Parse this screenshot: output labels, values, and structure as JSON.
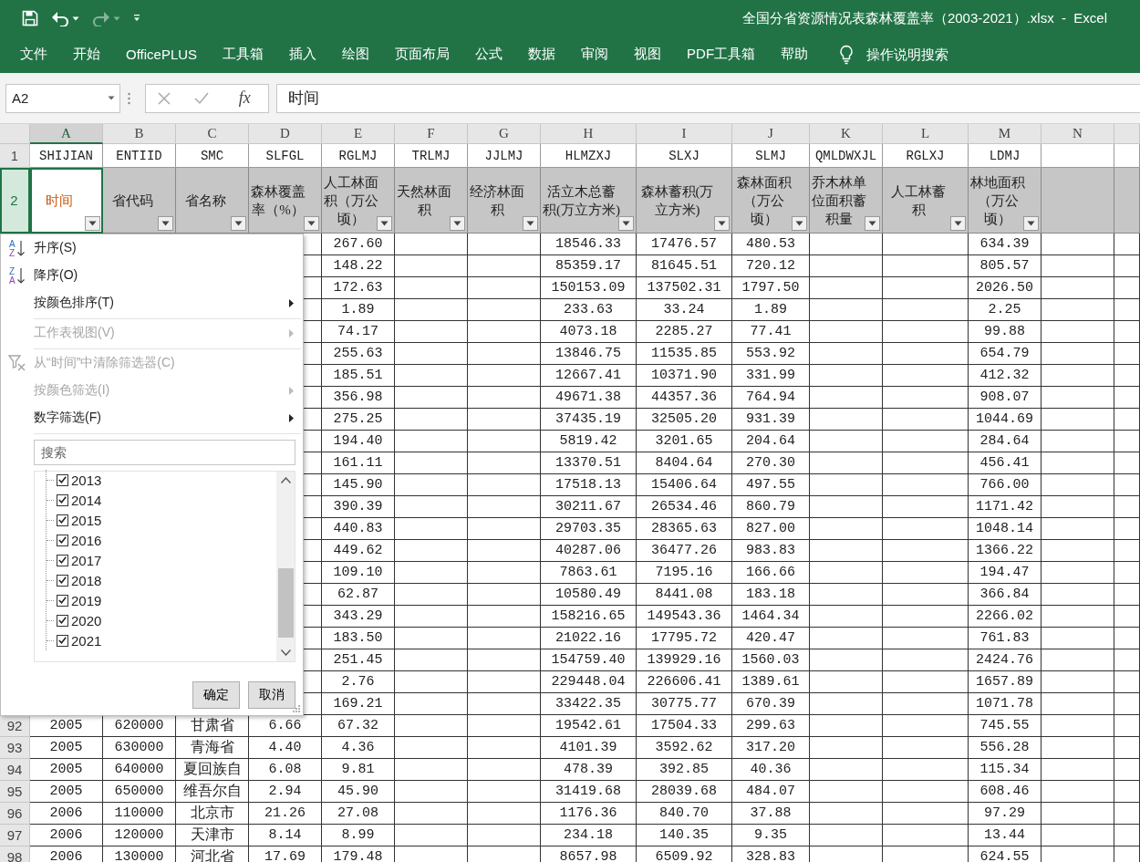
{
  "title_bar": {
    "quick_access": [
      {
        "kind": "save",
        "disabled": false
      },
      {
        "kind": "undo",
        "disabled": false
      },
      {
        "kind": "redo",
        "disabled": true
      },
      {
        "kind": "customize",
        "disabled": false
      }
    ],
    "title": "全国分省资源情况表森林覆盖率（2003-2021）.xlsx  -  Excel"
  },
  "ribbon": {
    "tabs": [
      {
        "label": "文件",
        "selected": false
      },
      {
        "label": "开始",
        "selected": false
      },
      {
        "label": "OfficePLUS",
        "selected": false
      },
      {
        "label": "工具箱",
        "selected": false
      },
      {
        "label": "插入",
        "selected": false
      },
      {
        "label": "绘图",
        "selected": false
      },
      {
        "label": "页面布局",
        "selected": false
      },
      {
        "label": "公式",
        "selected": false
      },
      {
        "label": "数据",
        "selected": false
      },
      {
        "label": "审阅",
        "selected": false
      },
      {
        "label": "视图",
        "selected": false
      },
      {
        "label": "PDF工具箱",
        "selected": false
      },
      {
        "label": "帮助",
        "selected": false
      }
    ],
    "tell_me": "操作说明搜索"
  },
  "formula_bar": {
    "name_box": "A2",
    "function_label": "fx",
    "value": "时间"
  },
  "sheet": {
    "columns": [
      {
        "letter": "A",
        "field": "SHIJIAN",
        "header": "时间",
        "selected": true
      },
      {
        "letter": "B",
        "field": "ENTIID",
        "header": "省代码",
        "selected": false
      },
      {
        "letter": "C",
        "field": "SMC",
        "header": "省名称",
        "selected": false
      },
      {
        "letter": "D",
        "field": "SLFGL",
        "header": "森林覆盖率（%）",
        "selected": false
      },
      {
        "letter": "E",
        "field": "RGLMJ",
        "header": "人工林面积（万公顷）",
        "selected": false
      },
      {
        "letter": "F",
        "field": "TRLMJ",
        "header": "天然林面积",
        "selected": false
      },
      {
        "letter": "G",
        "field": "JJLMJ",
        "header": "经济林面积",
        "selected": false
      },
      {
        "letter": "H",
        "field": "HLMZXJ",
        "header": "活立木总蓄积(万立方米)",
        "selected": false
      },
      {
        "letter": "I",
        "field": "SLXJ",
        "header": "森林蓄积(万立方米)",
        "selected": false
      },
      {
        "letter": "J",
        "field": "SLMJ",
        "header": "森林面积（万公顷）",
        "selected": false
      },
      {
        "letter": "K",
        "field": "QMLDWXJL",
        "header": "乔木林单位面积蓄积量",
        "selected": false
      },
      {
        "letter": "L",
        "field": "RGLXJ",
        "header": "人工林蓄积",
        "selected": false
      },
      {
        "letter": "M",
        "field": "LDMJ",
        "header": "林地面积（万公顷）",
        "selected": false
      },
      {
        "letter": "N",
        "selected": false
      }
    ],
    "field_row": {
      "number": "1"
    },
    "header_row": {
      "number": "2",
      "selected": true
    },
    "rows": [
      {
        "cells": {
          "E": "267.60",
          "H": "18546.33",
          "I": "17476.57",
          "J": "480.53",
          "M": "634.39"
        }
      },
      {
        "cells": {
          "E": "148.22",
          "H": "85359.17",
          "I": "81645.51",
          "J": "720.12",
          "M": "805.57"
        }
      },
      {
        "cells": {
          "E": "172.63",
          "H": "150153.09",
          "I": "137502.31",
          "J": "1797.50",
          "M": "2026.50"
        }
      },
      {
        "cells": {
          "E": "1.89",
          "H": "233.63",
          "I": "33.24",
          "J": "1.89",
          "M": "2.25"
        }
      },
      {
        "cells": {
          "E": "74.17",
          "H": "4073.18",
          "I": "2285.27",
          "J": "77.41",
          "M": "99.88"
        }
      },
      {
        "cells": {
          "E": "255.63",
          "H": "13846.75",
          "I": "11535.85",
          "J": "553.92",
          "M": "654.79"
        }
      },
      {
        "cells": {
          "E": "185.51",
          "H": "12667.41",
          "I": "10371.90",
          "J": "331.99",
          "M": "412.32"
        }
      },
      {
        "cells": {
          "E": "356.98",
          "H": "49671.38",
          "I": "44357.36",
          "J": "764.94",
          "M": "908.07"
        }
      },
      {
        "cells": {
          "E": "275.25",
          "H": "37435.19",
          "I": "32505.20",
          "J": "931.39",
          "M": "1044.69"
        }
      },
      {
        "cells": {
          "E": "194.40",
          "H": "5819.42",
          "I": "3201.65",
          "J": "204.64",
          "M": "284.64"
        }
      },
      {
        "cells": {
          "E": "161.11",
          "H": "13370.51",
          "I": "8404.64",
          "J": "270.30",
          "M": "456.41"
        }
      },
      {
        "cells": {
          "E": "145.90",
          "H": "17518.13",
          "I": "15406.64",
          "J": "497.55",
          "M": "766.00"
        }
      },
      {
        "cells": {
          "E": "390.39",
          "H": "30211.67",
          "I": "26534.46",
          "J": "860.79",
          "M": "1171.42"
        }
      },
      {
        "cells": {
          "E": "440.83",
          "H": "29703.35",
          "I": "28365.63",
          "J": "827.00",
          "M": "1048.14"
        }
      },
      {
        "cells": {
          "E": "449.62",
          "H": "40287.06",
          "I": "36477.26",
          "J": "983.83",
          "M": "1366.22"
        }
      },
      {
        "cells": {
          "E": "109.10",
          "H": "7863.61",
          "I": "7195.16",
          "J": "166.66",
          "M": "194.47"
        }
      },
      {
        "cells": {
          "E": "62.87",
          "H": "10580.49",
          "I": "8441.08",
          "J": "183.18",
          "M": "366.84"
        }
      },
      {
        "cells": {
          "E": "343.29",
          "H": "158216.65",
          "I": "149543.36",
          "J": "1464.34",
          "M": "2266.02"
        }
      },
      {
        "cells": {
          "E": "183.50",
          "H": "21022.16",
          "I": "17795.72",
          "J": "420.47",
          "M": "761.83"
        }
      },
      {
        "cells": {
          "E": "251.45",
          "H": "154759.40",
          "I": "139929.16",
          "J": "1560.03",
          "M": "2424.76"
        }
      },
      {
        "cells": {
          "E": "2.76",
          "H": "229448.04",
          "I": "226606.41",
          "J": "1389.61",
          "M": "1657.89"
        }
      },
      {
        "cells": {
          "E": "169.21",
          "H": "33422.35",
          "I": "30775.77",
          "J": "670.39",
          "M": "1071.78"
        }
      },
      {
        "number": "92",
        "cells": {
          "A": "2005",
          "B": "620000",
          "C": "甘肃省",
          "D": "6.66",
          "E": "67.32",
          "H": "19542.61",
          "I": "17504.33",
          "J": "299.63",
          "M": "745.55"
        }
      },
      {
        "number": "93",
        "cells": {
          "A": "2005",
          "B": "630000",
          "C": "青海省",
          "D": "4.40",
          "E": "4.36",
          "H": "4101.39",
          "I": "3592.62",
          "J": "317.20",
          "M": "556.28"
        }
      },
      {
        "number": "94",
        "cells": {
          "A": "2005",
          "B": "640000",
          "C": "夏回族自",
          "D": "6.08",
          "E": "9.81",
          "H": "478.39",
          "I": "392.85",
          "J": "40.36",
          "M": "115.34"
        }
      },
      {
        "number": "95",
        "cells": {
          "A": "2005",
          "B": "650000",
          "C": "维吾尔自",
          "D": "2.94",
          "E": "45.90",
          "H": "31419.68",
          "I": "28039.68",
          "J": "484.07",
          "M": "608.46"
        }
      },
      {
        "number": "96",
        "cells": {
          "A": "2006",
          "B": "110000",
          "C": "北京市",
          "D": "21.26",
          "E": "27.08",
          "H": "1176.36",
          "I": "840.70",
          "J": "37.88",
          "M": "97.29"
        }
      },
      {
        "number": "97",
        "cells": {
          "A": "2006",
          "B": "120000",
          "C": "天津市",
          "D": "8.14",
          "E": "8.99",
          "H": "234.18",
          "I": "140.35",
          "J": "9.35",
          "M": "13.44"
        }
      },
      {
        "number": "98",
        "cells": {
          "A": "2006",
          "B": "130000",
          "C": "河北省",
          "D": "17.69",
          "E": "179.48",
          "H": "8657.98",
          "I": "6509.92",
          "J": "328.83",
          "M": "624.55"
        }
      }
    ]
  },
  "filter_menu": {
    "items": [
      {
        "kind": "sort",
        "icon_letters": [
          "A",
          "Z"
        ],
        "label": "升序(S)",
        "disabled": false,
        "submenu": false,
        "divider_below": false
      },
      {
        "kind": "sort",
        "icon_letters": [
          "Z",
          "A"
        ],
        "label": "降序(O)",
        "disabled": false,
        "submenu": false,
        "divider_below": false
      },
      {
        "kind": "plain",
        "label": "按颜色排序(T)",
        "disabled": false,
        "submenu": true,
        "divider_below": true
      },
      {
        "kind": "plain",
        "label": "工作表视图(V)",
        "disabled": true,
        "submenu": true,
        "divider_below": true
      },
      {
        "kind": "clear_filter",
        "label": "从“时间”中清除筛选器(C)",
        "disabled": true,
        "submenu": false,
        "divider_below": false
      },
      {
        "kind": "plain",
        "label": "按颜色筛选(I)",
        "disabled": true,
        "submenu": true,
        "divider_below": false
      },
      {
        "kind": "plain",
        "label": "数字筛选(F)",
        "disabled": false,
        "submenu": true,
        "divider_below": true
      }
    ],
    "search": {
      "placeholder": "搜索"
    },
    "values": [
      {
        "label": "2013",
        "checked": true
      },
      {
        "label": "2014",
        "checked": true
      },
      {
        "label": "2015",
        "checked": true
      },
      {
        "label": "2016",
        "checked": true
      },
      {
        "label": "2017",
        "checked": true
      },
      {
        "label": "2018",
        "checked": true
      },
      {
        "label": "2019",
        "checked": true
      },
      {
        "label": "2020",
        "checked": true
      },
      {
        "label": "2021",
        "checked": true
      }
    ],
    "buttons": [
      "确定",
      "取消"
    ]
  }
}
